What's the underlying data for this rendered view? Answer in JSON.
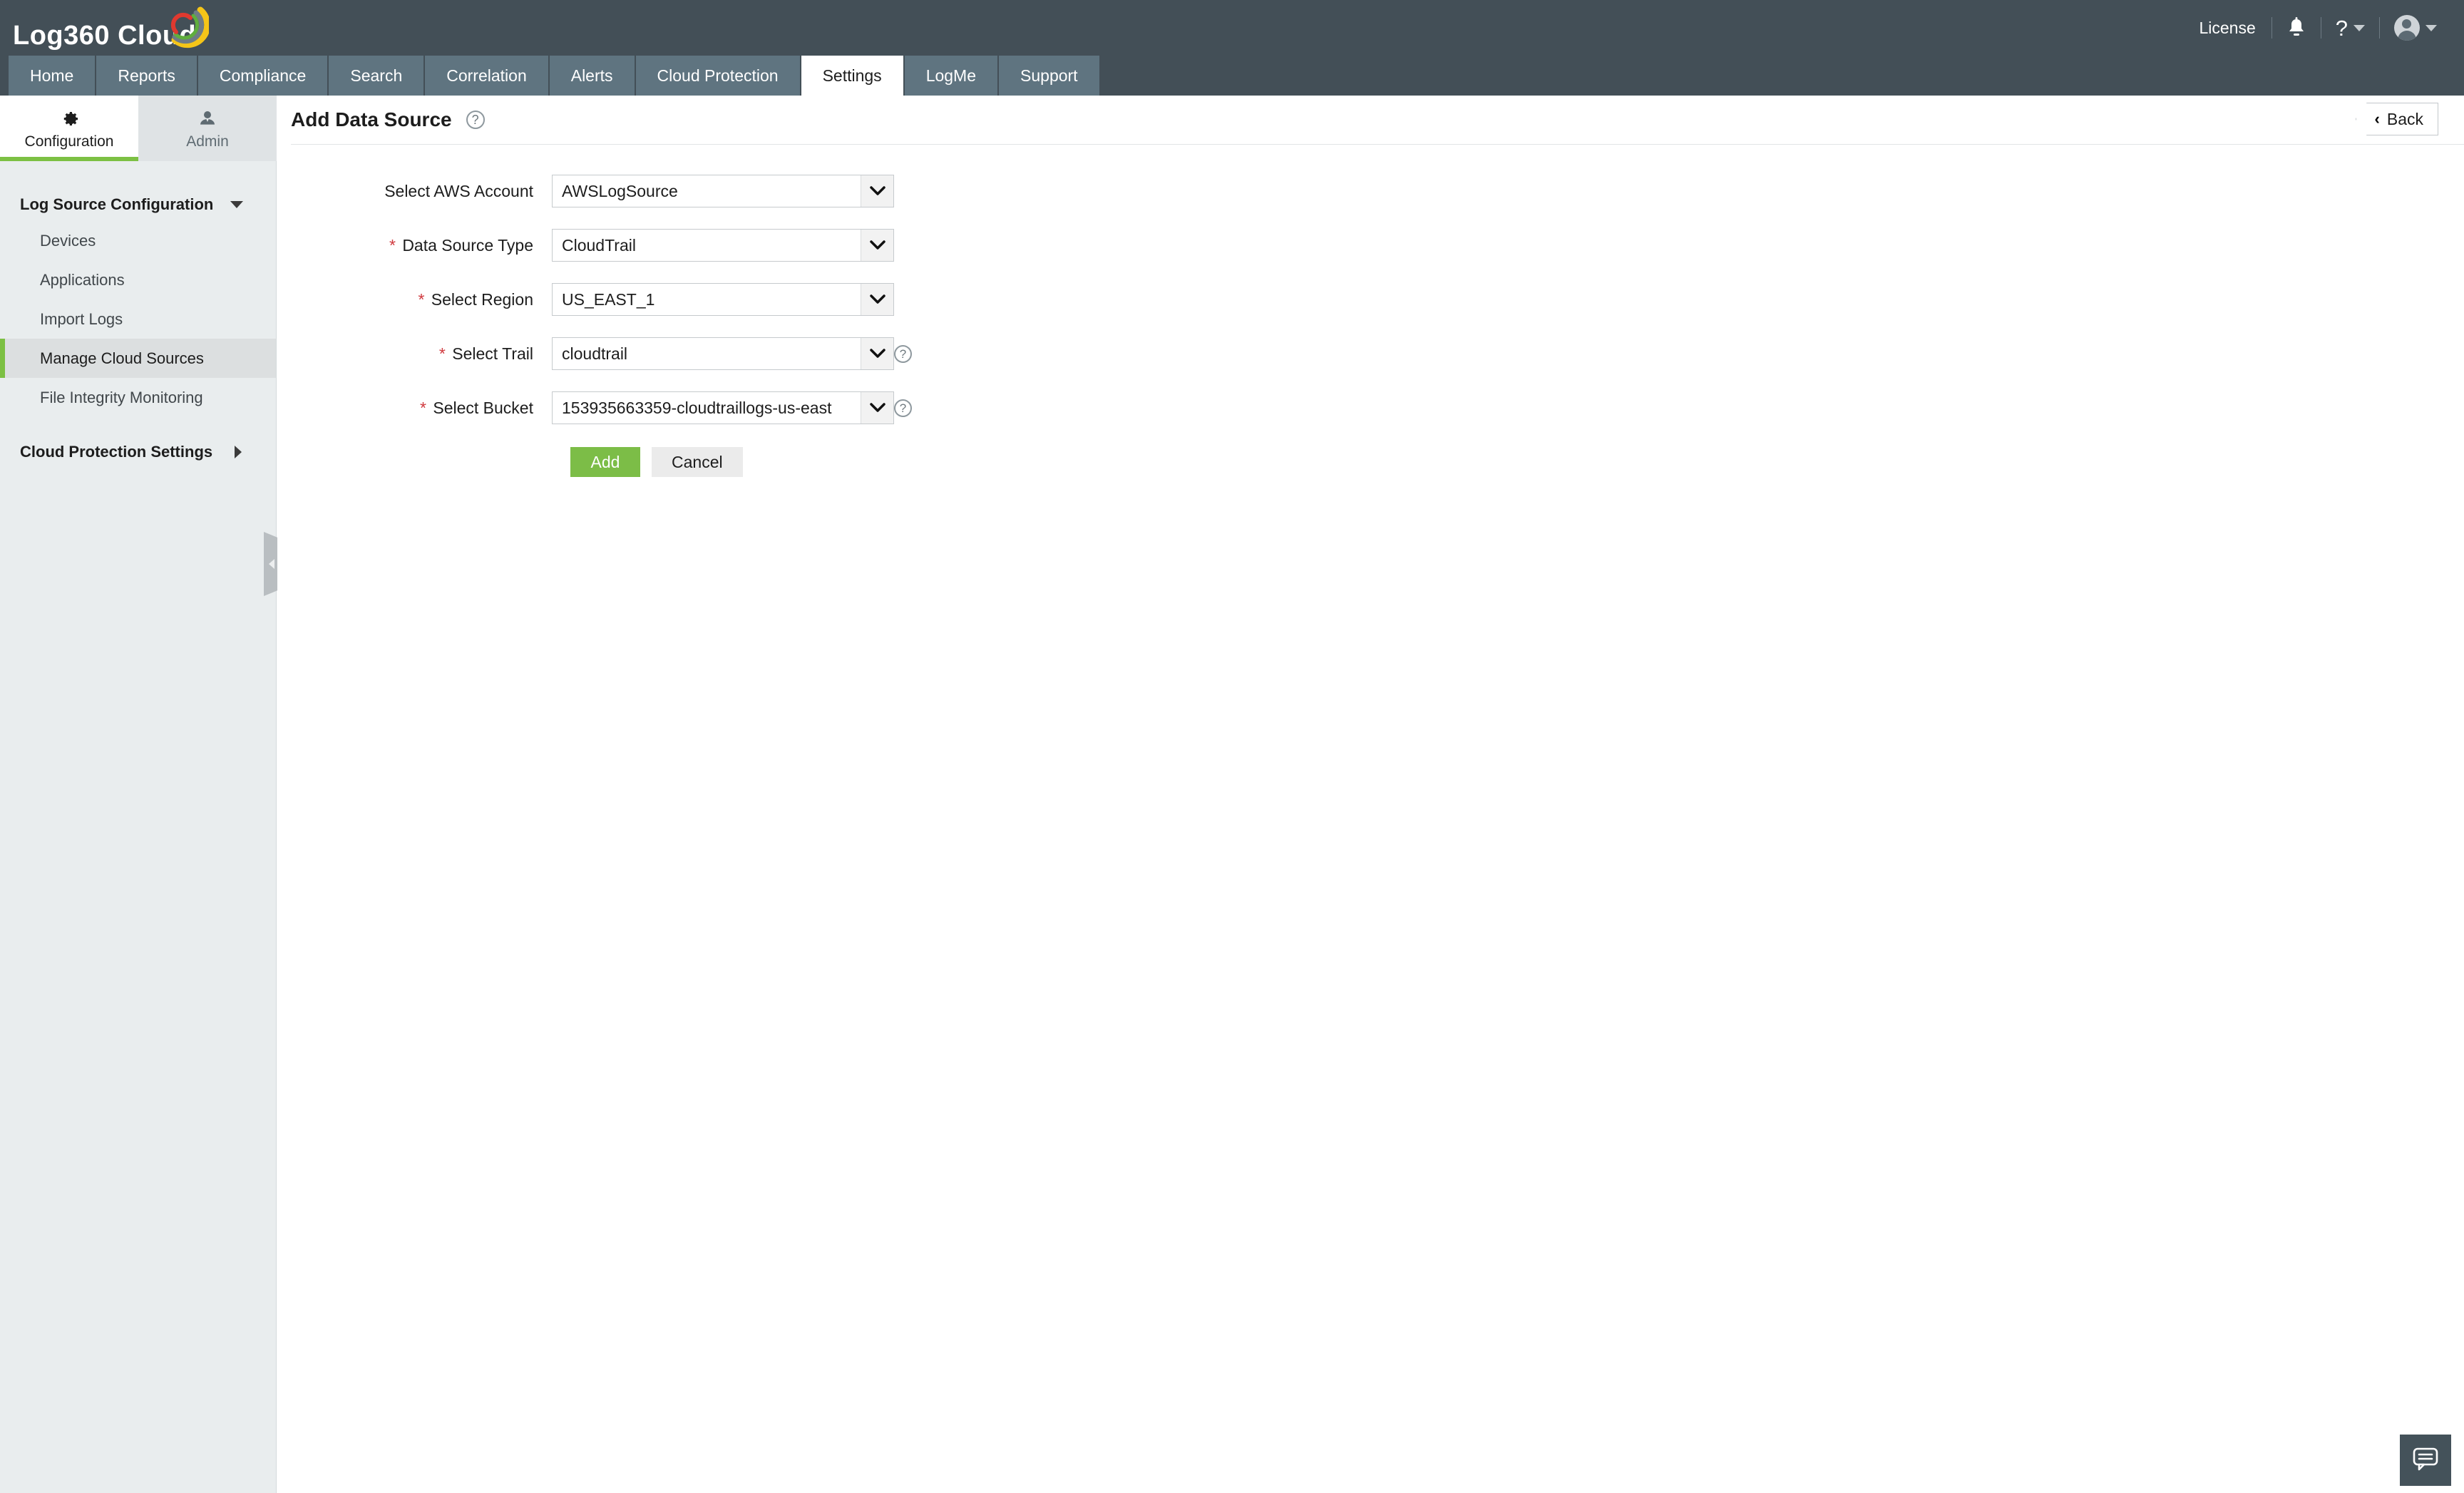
{
  "brand": {
    "name_part1": "Log360",
    "name_part2": "Cloud",
    "logo_colors": {
      "outer": "#f5c518",
      "gray": "#6f7c84",
      "green": "#5fae3d",
      "red": "#e0392f"
    }
  },
  "topbar": {
    "license_label": "License",
    "notifications_icon": "bell-icon",
    "help_label": "?",
    "help_icon": "question-mark-icon",
    "profile_icon": "user-avatar-icon"
  },
  "nav": {
    "tabs": [
      {
        "label": "Home",
        "active": false
      },
      {
        "label": "Reports",
        "active": false
      },
      {
        "label": "Compliance",
        "active": false
      },
      {
        "label": "Search",
        "active": false
      },
      {
        "label": "Correlation",
        "active": false
      },
      {
        "label": "Alerts",
        "active": false
      },
      {
        "label": "Cloud Protection",
        "active": false
      },
      {
        "label": "Settings",
        "active": true
      },
      {
        "label": "LogMe",
        "active": false
      },
      {
        "label": "Support",
        "active": false
      }
    ]
  },
  "sidebar": {
    "tabs": [
      {
        "label": "Configuration",
        "icon": "gear-icon",
        "active": true
      },
      {
        "label": "Admin",
        "icon": "user-tie-icon",
        "active": false
      }
    ],
    "group_title": "Log Source Configuration",
    "items": [
      {
        "label": "Devices",
        "selected": false
      },
      {
        "label": "Applications",
        "selected": false
      },
      {
        "label": "Import Logs",
        "selected": false
      },
      {
        "label": "Manage Cloud Sources",
        "selected": true
      },
      {
        "label": "File Integrity Monitoring",
        "selected": false
      }
    ],
    "secondary_group_title": "Cloud Protection Settings",
    "accent_color": "#7cc043"
  },
  "page": {
    "title": "Add Data Source",
    "title_help_icon": "help-icon",
    "back_label": "Back",
    "back_chevron": "‹"
  },
  "form": {
    "fields": [
      {
        "label": "Select AWS Account",
        "required": false,
        "value": "AWSLogSource",
        "has_help": false
      },
      {
        "label": "Data Source Type",
        "required": true,
        "value": "CloudTrail",
        "has_help": false
      },
      {
        "label": "Select Region",
        "required": true,
        "value": "US_EAST_1",
        "has_help": false
      },
      {
        "label": "Select Trail",
        "required": true,
        "value": "cloudtrail",
        "has_help": true
      },
      {
        "label": "Select Bucket",
        "required": true,
        "value": "153935663359-cloudtraillogs-us-east",
        "has_help": true
      }
    ],
    "required_marker": "*",
    "submit_label": "Add",
    "cancel_label": "Cancel",
    "submit_color": "#7cbd47"
  },
  "chat": {
    "icon": "chat-bubble-icon"
  }
}
